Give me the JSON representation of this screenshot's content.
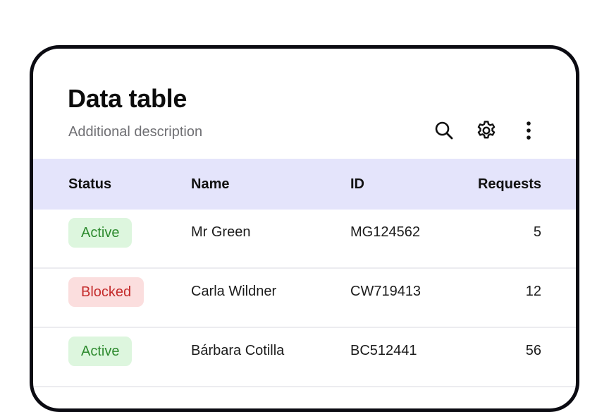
{
  "header": {
    "title": "Data table",
    "description": "Additional description"
  },
  "toolbar": {
    "search_icon": "search-icon",
    "settings_icon": "gear-icon",
    "more_icon": "more-vertical-icon"
  },
  "table": {
    "columns": [
      "Status",
      "Name",
      "ID",
      "Requests"
    ],
    "rows": [
      {
        "status": "Active",
        "status_type": "active",
        "name": "Mr Green",
        "id": "MG124562",
        "requests": "5"
      },
      {
        "status": "Blocked",
        "status_type": "blocked",
        "name": "Carla Wildner",
        "id": "CW719413",
        "requests": "12"
      },
      {
        "status": "Active",
        "status_type": "active",
        "name": "Bárbara Cotilla",
        "id": "BC512441",
        "requests": "56"
      }
    ]
  },
  "colors": {
    "header_bg": "#e4e4fb",
    "active_bg": "#ddf6de",
    "active_text": "#2d8a2e",
    "blocked_bg": "#fbdede",
    "blocked_text": "#c42b2b"
  }
}
